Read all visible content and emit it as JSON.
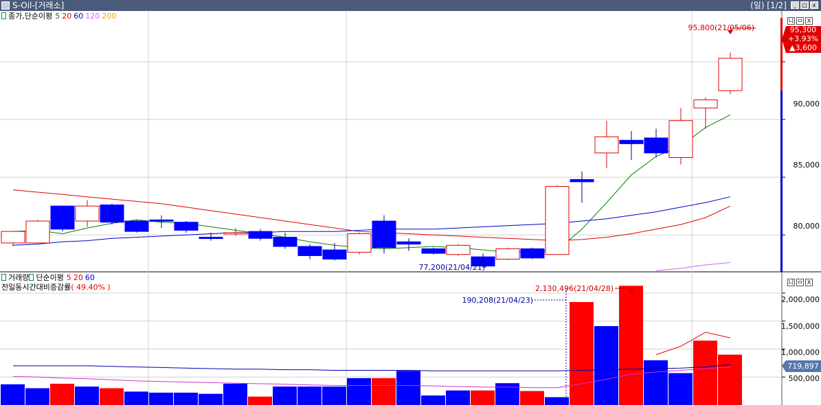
{
  "window": {
    "title": "S-Oil-[거래소]",
    "period": "(일) [1/2]"
  },
  "price_pane": {
    "legend": {
      "label": "종가,단순이평",
      "ma": [
        "5",
        "20",
        "60",
        "120",
        "200"
      ],
      "colors": [
        "#008000",
        "#e00000",
        "#0000cc",
        "#cc66ff",
        "#ff9900"
      ]
    },
    "buttons": [
      "니",
      "ㅁ",
      "X"
    ],
    "current": {
      "price": "95,300",
      "pct": "+3.93%",
      "change": "▲3,600"
    },
    "max_label": "95,800(21/05/06)",
    "min_label": "77,200(21/04/21)",
    "yticks": [
      "90,000",
      "85,000",
      "80,000"
    ]
  },
  "volume_pane": {
    "legend": {
      "label": "거래량",
      "label2": "단순이평",
      "ma": [
        "5",
        "20",
        "60"
      ],
      "colors": [
        "#e00000",
        "#e00000",
        "#0000cc"
      ]
    },
    "sublabel": "전일동시간대비증감률",
    "sub_pct": "( 49.40% )",
    "buttons": [
      "니",
      "ㅁ",
      "X"
    ],
    "max_label": "2,130,496(21/04/28)",
    "ref_label": "190,208(21/04/23)",
    "current_ma": "719,897",
    "yticks": [
      "2,000,000",
      "1,500,000",
      "1,000,000",
      "500,000"
    ]
  },
  "chart_data": [
    {
      "type": "candlestick",
      "candles": [
        {
          "o": 79300,
          "h": 80200,
          "l": 79000,
          "c": 80300
        },
        {
          "o": 79300,
          "h": 81300,
          "l": 79300,
          "c": 81200
        },
        {
          "o": 82500,
          "h": 82500,
          "l": 80300,
          "c": 80500
        },
        {
          "o": 81200,
          "h": 83000,
          "l": 80700,
          "c": 82500
        },
        {
          "o": 82600,
          "h": 82700,
          "l": 80900,
          "c": 81100
        },
        {
          "o": 81200,
          "h": 81300,
          "l": 80200,
          "c": 80300
        },
        {
          "o": 81300,
          "h": 81700,
          "l": 80600,
          "c": 81200
        },
        {
          "o": 81100,
          "h": 81200,
          "l": 80200,
          "c": 80400
        },
        {
          "o": 79800,
          "h": 80200,
          "l": 79500,
          "c": 79700
        },
        {
          "o": 80100,
          "h": 80600,
          "l": 79900,
          "c": 80200
        },
        {
          "o": 80300,
          "h": 80500,
          "l": 79500,
          "c": 79700
        },
        {
          "o": 79800,
          "h": 80200,
          "l": 78800,
          "c": 79000
        },
        {
          "o": 79000,
          "h": 79200,
          "l": 77900,
          "c": 78200
        },
        {
          "o": 78700,
          "h": 79300,
          "l": 77800,
          "c": 77900
        },
        {
          "o": 78500,
          "h": 80200,
          "l": 78300,
          "c": 80100
        },
        {
          "o": 81200,
          "h": 81700,
          "l": 78400,
          "c": 78900
        },
        {
          "o": 79400,
          "h": 79700,
          "l": 78600,
          "c": 79200
        },
        {
          "o": 78800,
          "h": 78900,
          "l": 78300,
          "c": 78400
        },
        {
          "o": 78300,
          "h": 79200,
          "l": 78200,
          "c": 79100
        },
        {
          "o": 78100,
          "h": 78400,
          "l": 77200,
          "c": 77300
        },
        {
          "o": 77900,
          "h": 78900,
          "l": 77800,
          "c": 78800
        },
        {
          "o": 78800,
          "h": 78900,
          "l": 77900,
          "c": 78000
        },
        {
          "o": 78300,
          "h": 84300,
          "l": 78300,
          "c": 84200
        },
        {
          "o": 84800,
          "h": 85500,
          "l": 82800,
          "c": 84600
        },
        {
          "o": 87100,
          "h": 89900,
          "l": 85800,
          "c": 88500
        },
        {
          "o": 88200,
          "h": 89000,
          "l": 86500,
          "c": 87900
        },
        {
          "o": 88400,
          "h": 89200,
          "l": 86700,
          "c": 87100
        },
        {
          "o": 86700,
          "h": 91000,
          "l": 86100,
          "c": 89900
        },
        {
          "o": 91000,
          "h": 91900,
          "l": 89200,
          "c": 91700
        },
        {
          "o": 92500,
          "h": 95800,
          "l": 92200,
          "c": 95300
        }
      ],
      "ma": {
        "5": [
          80300,
          80400,
          80100,
          80600,
          81000,
          81300,
          81100,
          81000,
          80700,
          80400,
          80100,
          79800,
          79400,
          79100,
          78900,
          78800,
          78900,
          79000,
          78900,
          78700,
          78500,
          78500,
          78700,
          80500,
          82800,
          85200,
          86800,
          87700,
          89300,
          90400
        ],
        "20": [
          83900,
          83700,
          83500,
          83300,
          83100,
          82900,
          82700,
          82400,
          82100,
          81800,
          81500,
          81200,
          80900,
          80600,
          80300,
          80200,
          80100,
          80000,
          79900,
          79800,
          79700,
          79600,
          79500,
          79600,
          79800,
          80100,
          80500,
          80900,
          81500,
          82500
        ],
        "60": [
          79100,
          79200,
          79400,
          79500,
          79700,
          79800,
          79900,
          80000,
          80100,
          80200,
          80200,
          80300,
          80300,
          80300,
          80400,
          80500,
          80500,
          80500,
          80600,
          80700,
          80800,
          80900,
          81000,
          81200,
          81400,
          81700,
          82000,
          82400,
          82800,
          83300
        ],
        "120": [
          null,
          null,
          null,
          null,
          null,
          null,
          null,
          null,
          null,
          null,
          null,
          null,
          null,
          null,
          null,
          null,
          null,
          null,
          null,
          null,
          null,
          null,
          null,
          null,
          null,
          null,
          76900,
          77100,
          77400,
          77600
        ]
      },
      "ylim": [
        76800,
        99400
      ]
    },
    {
      "type": "bar",
      "values": [
        370000,
        300000,
        380000,
        330000,
        300000,
        240000,
        220000,
        220000,
        200000,
        380000,
        150000,
        330000,
        330000,
        330000,
        480000,
        480000,
        610000,
        170000,
        260000,
        260000,
        390000,
        250000,
        140000,
        1840000,
        1410000,
        2130496,
        800000,
        570000,
        1150000,
        900000
      ],
      "colors": [
        "blue",
        "blue",
        "red",
        "blue",
        "red",
        "blue",
        "blue",
        "blue",
        "blue",
        "blue",
        "red",
        "blue",
        "blue",
        "blue",
        "blue",
        "red",
        "blue",
        "blue",
        "blue",
        "red",
        "blue",
        "red",
        "blue",
        "red",
        "blue",
        "red",
        "blue",
        "blue",
        "red",
        "red"
      ],
      "ma": {
        "5": [
          null,
          null,
          null,
          null,
          null,
          null,
          null,
          null,
          null,
          null,
          null,
          null,
          null,
          null,
          null,
          null,
          null,
          null,
          null,
          null,
          null,
          null,
          null,
          null,
          null,
          null,
          900000,
          1050000,
          1300000,
          1200000
        ],
        "20": [
          510000,
          500000,
          480000,
          470000,
          450000,
          430000,
          420000,
          410000,
          400000,
          390000,
          380000,
          370000,
          360000,
          350000,
          350000,
          350000,
          350000,
          340000,
          330000,
          320000,
          320000,
          310000,
          310000,
          380000,
          460000,
          550000,
          590000,
          620000,
          650000,
          680000
        ],
        "60": [
          700000,
          700000,
          700000,
          700000,
          690000,
          680000,
          670000,
          660000,
          650000,
          640000,
          640000,
          630000,
          630000,
          620000,
          620000,
          620000,
          620000,
          610000,
          610000,
          610000,
          610000,
          610000,
          610000,
          620000,
          630000,
          640000,
          650000,
          660000,
          680000,
          720000
        ]
      },
      "ylim": [
        0,
        2380000
      ]
    }
  ]
}
